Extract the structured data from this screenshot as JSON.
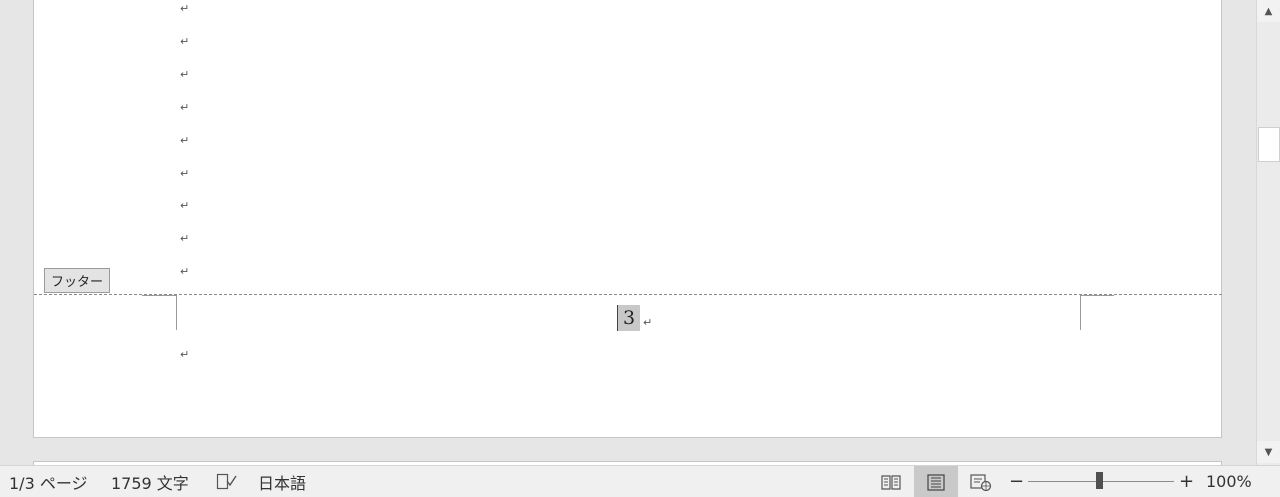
{
  "document": {
    "paragraph_mark": "↵",
    "footer_label": "フッター",
    "page_number": "3"
  },
  "statusbar": {
    "page_info": "1/3 ページ",
    "word_count": "1759 文字",
    "language": "日本語",
    "zoom_level": "100%",
    "zoom_minus": "−",
    "zoom_plus": "+",
    "zoom_fraction": 0.5,
    "views": [
      "read-mode-icon",
      "print-layout-icon",
      "web-layout-icon"
    ],
    "active_view": "print-layout-icon"
  },
  "scrollbar": {
    "up_arrow": "▲",
    "down_arrow": "▼"
  }
}
